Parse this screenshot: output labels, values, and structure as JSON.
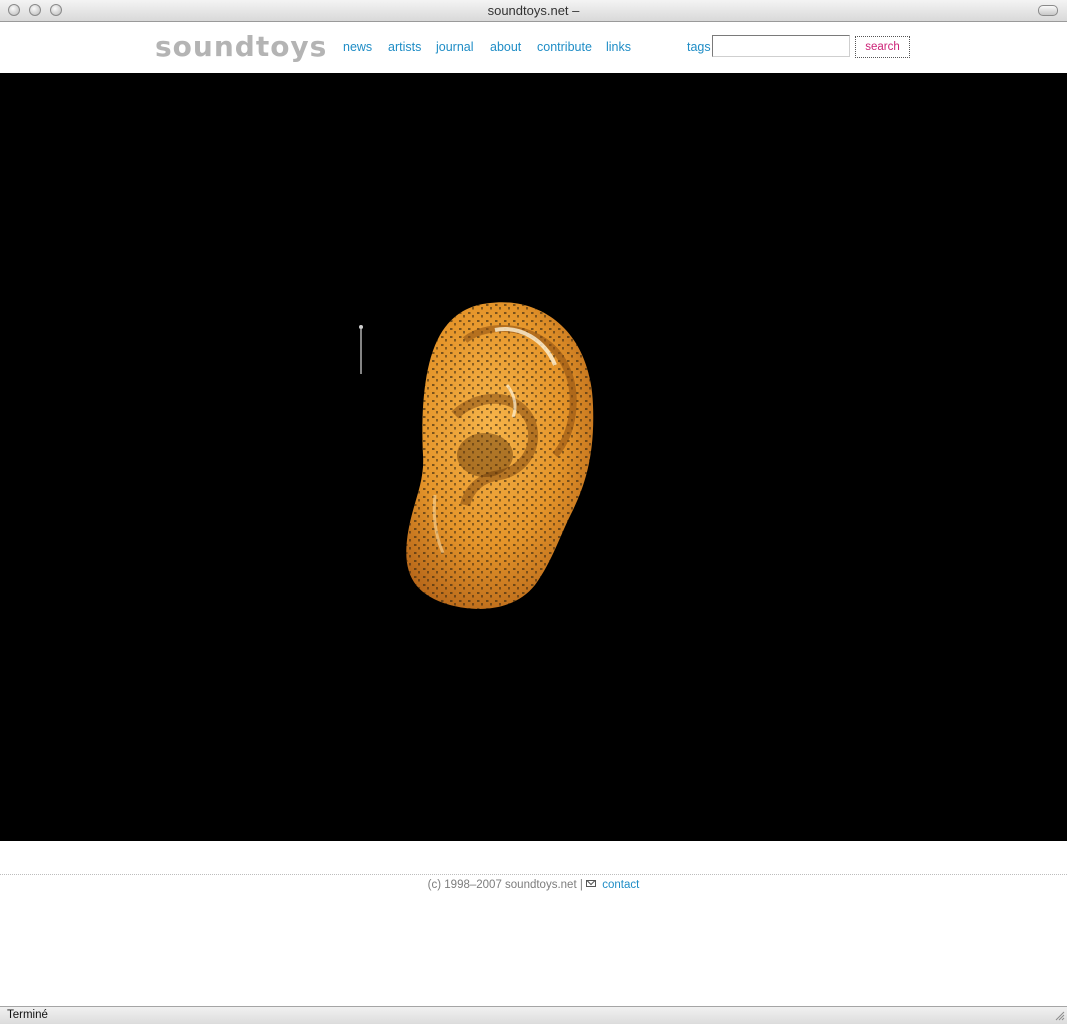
{
  "window": {
    "title": "soundtoys.net –"
  },
  "header": {
    "logo_text": "soundtoys",
    "nav": [
      "news",
      "artists",
      "journal",
      "about",
      "contribute",
      "links"
    ],
    "tags_label": "tags",
    "search_input": {
      "value": "",
      "placeholder": ""
    },
    "search_button": "search"
  },
  "footer": {
    "copyright": "(c) 1998–2007 soundtoys.net |",
    "contact": "contact",
    "mail_icon": "envelope-icon"
  },
  "status": {
    "text": "Terminé"
  },
  "colors": {
    "link": "#1f8dc6",
    "search_button": "#cc2277",
    "logo": "#b4b4b4",
    "stage": "#000000"
  }
}
